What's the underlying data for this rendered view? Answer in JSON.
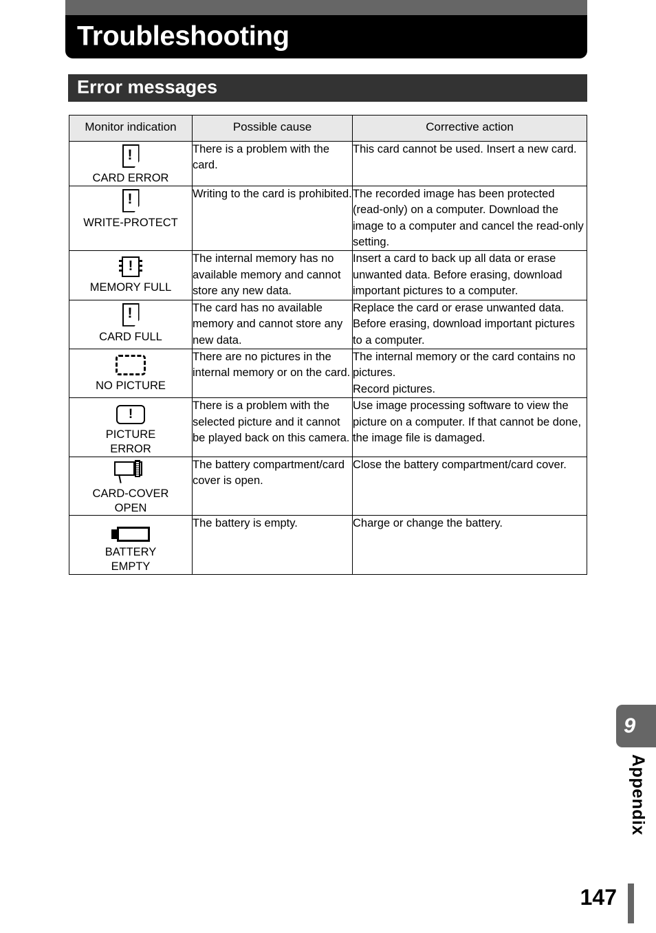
{
  "page": {
    "chapter_title": "Troubleshooting",
    "section_heading": "Error messages",
    "number": "147",
    "tab_number": "9",
    "tab_label": "Appendix",
    "colors": {
      "top_strip": "#666666",
      "chapter_bar": "#000000",
      "section_bar": "#333333",
      "table_header": "#e8e8e8",
      "tab": "#666666",
      "rule": "#666666"
    }
  },
  "table": {
    "headers": [
      "Monitor indication",
      "Possible cause",
      "Corrective action"
    ],
    "rows": [
      {
        "icon": "memory-card-error-icon",
        "indication": "CARD ERROR",
        "cause": "There is a problem with the card.",
        "action": "This card cannot be used. Insert a new card."
      },
      {
        "icon": "memory-card-write-protect-icon",
        "indication": "WRITE-PROTECT",
        "cause": "Writing to the card is prohibited.",
        "action": "The recorded image has been protected (read-only) on a computer. Download the image to a computer and cancel the read-only setting."
      },
      {
        "icon": "internal-memory-chip-icon",
        "indication": "MEMORY FULL",
        "cause": "The internal memory has no available memory and cannot store any new data.",
        "action": "Insert a card to back up all data or erase unwanted data. Before erasing, download important pictures to a computer."
      },
      {
        "icon": "memory-card-full-icon",
        "indication": "CARD FULL",
        "cause": "The card has no available memory and cannot store any new data.",
        "action": "Replace the card or erase unwanted data. Before erasing, download important pictures to a computer."
      },
      {
        "icon": "empty-frame-dashed-icon",
        "indication": "NO PICTURE",
        "cause": "There are no pictures in the internal memory or on the card.",
        "action": "The internal memory or the card contains no pictures.\nRecord pictures."
      },
      {
        "icon": "picture-error-frame-icon",
        "indication": "PICTURE\nERROR",
        "cause": "There is a problem with the selected picture and it cannot be played back on this camera.",
        "action": "Use image processing software to view the picture on a computer. If that cannot be done, the image file is damaged."
      },
      {
        "icon": "camera-card-cover-open-icon",
        "indication": "CARD-COVER\nOPEN",
        "cause": "The battery compartment/card cover is open.",
        "action": "Close the battery compartment/card cover."
      },
      {
        "icon": "battery-empty-icon",
        "indication": "BATTERY\nEMPTY",
        "cause": "The battery is empty.",
        "action": "Charge or change the battery."
      }
    ]
  }
}
